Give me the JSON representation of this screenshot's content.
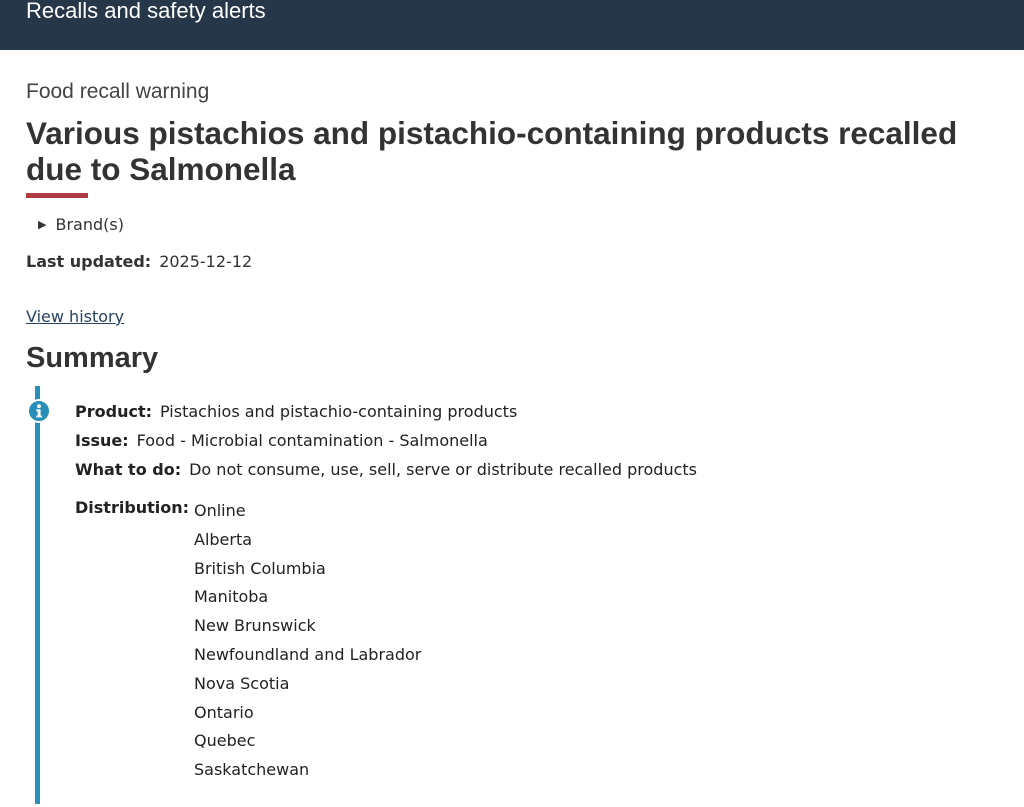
{
  "header": {
    "section_title": "Recalls and safety alerts"
  },
  "recall": {
    "type_label": "Food recall warning",
    "title": "Various pistachios and pistachio-containing products recalled due to Salmonella",
    "brands_toggle": "Brand(s)",
    "last_updated_label": "Last updated:",
    "last_updated_value": "2025-12-12",
    "view_history": "View history"
  },
  "summary": {
    "heading": "Summary",
    "product_label": "Product:",
    "product_value": "Pistachios and pistachio-containing products",
    "issue_label": "Issue:",
    "issue_value": "Food - Microbial contamination - Salmonella",
    "what_to_do_label": "What to do:",
    "what_to_do_value": "Do not consume, use, sell, serve or distribute recalled products",
    "distribution_label": "Distribution:",
    "distribution": [
      "Online",
      "Alberta",
      "British Columbia",
      "Manitoba",
      "New Brunswick",
      "Newfoundland and Labrador",
      "Nova Scotia",
      "Ontario",
      "Quebec",
      "Saskatchewan"
    ]
  },
  "icons": {
    "info": "info-icon",
    "disclosure": "triangle-right-icon"
  },
  "colors": {
    "header_bg": "#26374a",
    "title_accent": "#af3c43",
    "summary_accent": "#2a8fb7",
    "link": "#284162"
  }
}
